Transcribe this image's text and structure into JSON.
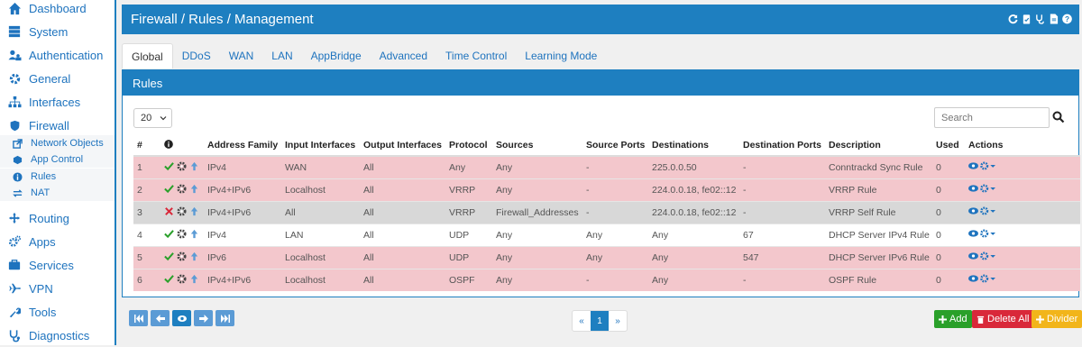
{
  "sidebar": {
    "items": [
      {
        "label": "Dashboard",
        "icon": "home-icon"
      },
      {
        "label": "System",
        "icon": "server-icon"
      },
      {
        "label": "Authentication",
        "icon": "users-icon"
      },
      {
        "label": "General",
        "icon": "gear-icon"
      },
      {
        "label": "Interfaces",
        "icon": "sitemap-icon"
      },
      {
        "label": "Firewall",
        "icon": "shield-icon"
      },
      {
        "label": "Routing",
        "icon": "arrows-icon"
      },
      {
        "label": "Apps",
        "icon": "cogs-icon"
      },
      {
        "label": "Services",
        "icon": "briefcase-icon"
      },
      {
        "label": "VPN",
        "icon": "plane-icon"
      },
      {
        "label": "Tools",
        "icon": "wrench-icon"
      },
      {
        "label": "Diagnostics",
        "icon": "stethoscope-icon"
      }
    ],
    "firewall_sub": [
      {
        "label": "Network Objects",
        "icon": "external-link-icon"
      },
      {
        "label": "App Control",
        "icon": "cube-icon"
      },
      {
        "label": "Rules",
        "icon": "info-circle-icon"
      },
      {
        "label": "NAT",
        "icon": "exchange-icon"
      }
    ]
  },
  "header": {
    "title": "Firewall / Rules / Management"
  },
  "tabs": [
    "Global",
    "DDoS",
    "WAN",
    "LAN",
    "AppBridge",
    "Advanced",
    "Time Control",
    "Learning Mode"
  ],
  "panel": {
    "title": "Rules",
    "page_size": "20",
    "search_placeholder": "Search"
  },
  "table": {
    "headers": [
      "#",
      "",
      "Address Family",
      "Input Interfaces",
      "Output Interfaces",
      "Protocol",
      "Sources",
      "Source Ports",
      "Destinations",
      "Destination Ports",
      "Description",
      "Used",
      "Actions"
    ],
    "rows": [
      {
        "num": "1",
        "enabled": true,
        "family": "IPv4",
        "in": "WAN",
        "out": "All",
        "proto": "Any",
        "src": "Any",
        "sport": "-",
        "dst": "225.0.0.50",
        "dport": "-",
        "desc": "Conntrackd Sync Rule",
        "used": "0",
        "style": "pink"
      },
      {
        "num": "2",
        "enabled": true,
        "family": "IPv4+IPv6",
        "in": "Localhost",
        "out": "All",
        "proto": "VRRP",
        "src": "Any",
        "sport": "-",
        "dst": "224.0.0.18, fe02::12",
        "dport": "-",
        "desc": "VRRP Rule",
        "used": "0",
        "style": "pink"
      },
      {
        "num": "3",
        "enabled": false,
        "family": "IPv4+IPv6",
        "in": "All",
        "out": "All",
        "proto": "VRRP",
        "src": "Firewall_Addresses",
        "sport": "-",
        "dst": "224.0.0.18, fe02::12",
        "dport": "-",
        "desc": "VRRP Self Rule",
        "used": "0",
        "style": "grey"
      },
      {
        "num": "4",
        "enabled": true,
        "family": "IPv4",
        "in": "LAN",
        "out": "All",
        "proto": "UDP",
        "src": "Any",
        "sport": "Any",
        "dst": "Any",
        "dport": "67",
        "desc": "DHCP Server IPv4 Rule",
        "used": "0",
        "style": "white"
      },
      {
        "num": "5",
        "enabled": true,
        "family": "IPv6",
        "in": "Localhost",
        "out": "All",
        "proto": "UDP",
        "src": "Any",
        "sport": "Any",
        "dst": "Any",
        "dport": "547",
        "desc": "DHCP Server IPv6 Rule",
        "used": "0",
        "style": "pink"
      },
      {
        "num": "6",
        "enabled": true,
        "family": "IPv4+IPv6",
        "in": "Localhost",
        "out": "All",
        "proto": "OSPF",
        "src": "Any",
        "sport": "-",
        "dst": "Any",
        "dport": "-",
        "desc": "OSPF Rule",
        "used": "0",
        "style": "pink"
      }
    ]
  },
  "pager": {
    "prev": "«",
    "current": "1",
    "next": "»"
  },
  "buttons": {
    "add": "Add",
    "delete_all": "Delete All",
    "divider": "Divider"
  },
  "colors": {
    "primary": "#1e7fc0",
    "pink_row": "#f3c7cc",
    "grey_row": "#d8d8d8",
    "green": "#2aa02a",
    "red": "#d9283a",
    "yellow": "#f2b51a"
  }
}
